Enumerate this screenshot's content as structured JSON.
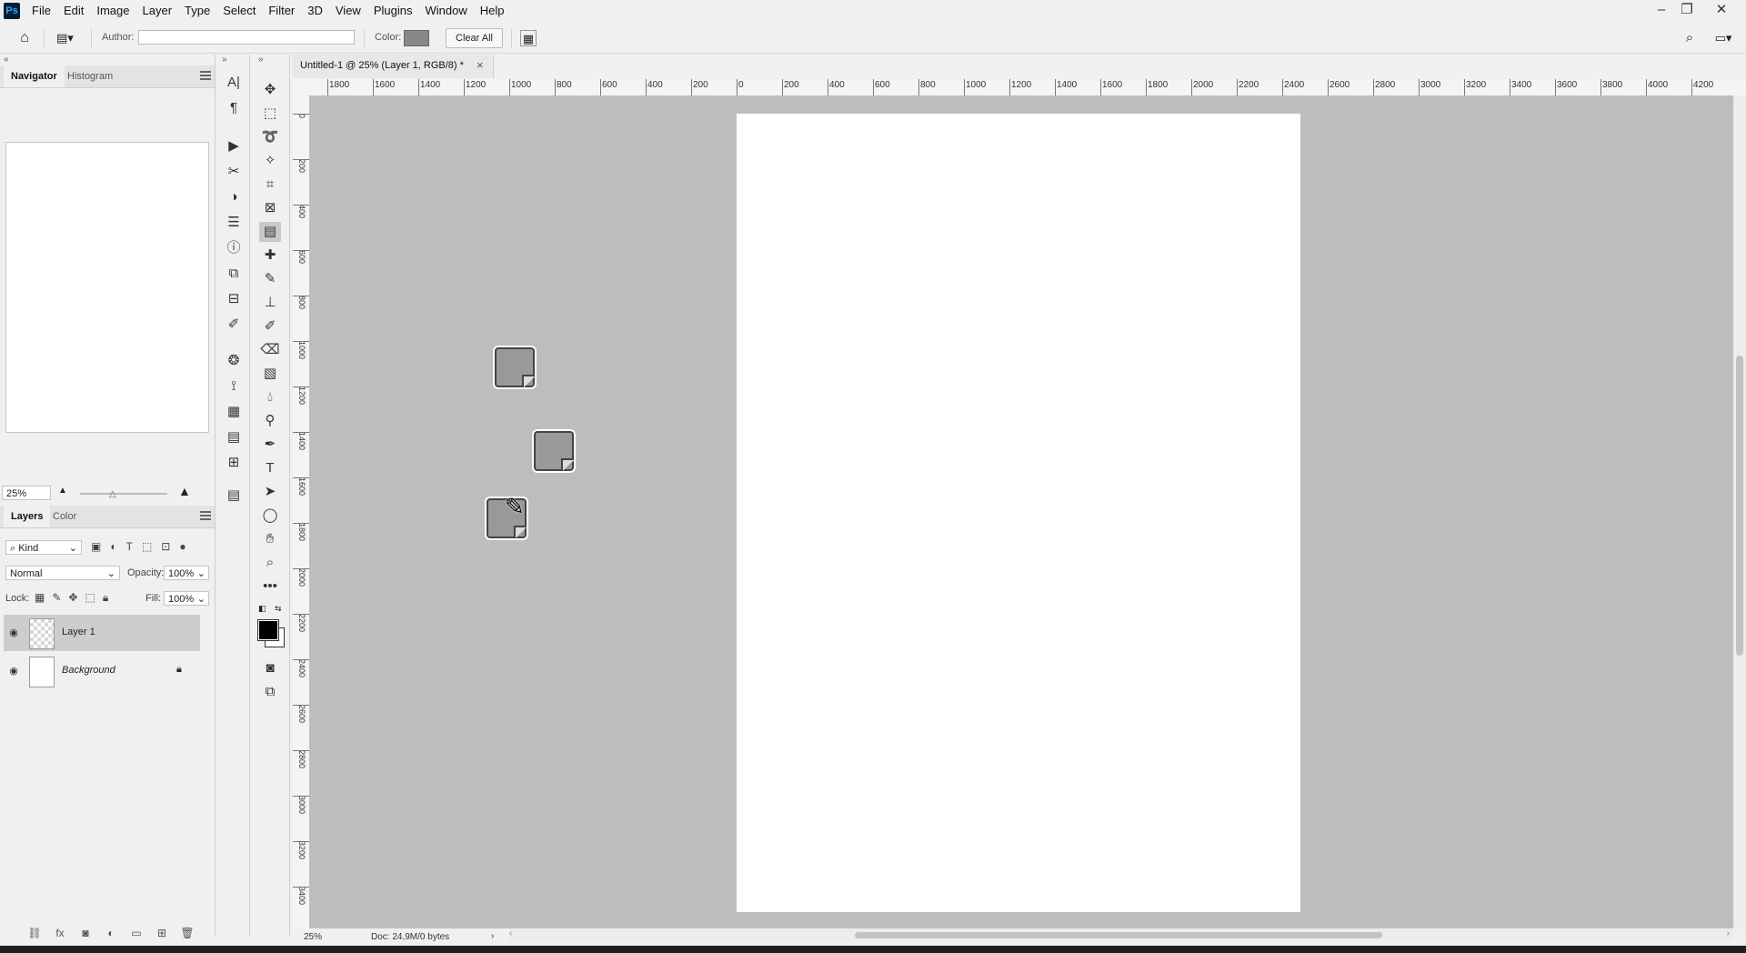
{
  "app": {
    "logo": "Ps"
  },
  "menu": [
    "File",
    "Edit",
    "Image",
    "Layer",
    "Type",
    "Select",
    "Filter",
    "3D",
    "View",
    "Plugins",
    "Window",
    "Help"
  ],
  "window_controls": {
    "minimize": "–",
    "restore": "❐",
    "close": "✕"
  },
  "options_bar": {
    "author_label": "Author:",
    "author_value": "",
    "color_label": "Color:",
    "color_value": "#888888",
    "clear_all_label": "Clear All"
  },
  "navigator_panel": {
    "tabs": [
      "Navigator",
      "Histogram"
    ],
    "zoom_value": "25%"
  },
  "layers_panel": {
    "tabs": [
      "Layers",
      "Color"
    ],
    "filter_kind": "Kind",
    "blend_mode": "Normal",
    "opacity_label": "Opacity:",
    "opacity_value": "100%",
    "lock_label": "Lock:",
    "fill_label": "Fill:",
    "fill_value": "100%",
    "layers": [
      {
        "name": "Layer 1",
        "selected": true
      },
      {
        "name": "Background",
        "selected": false,
        "locked": true
      }
    ]
  },
  "document": {
    "tab_title": "Untitled-1 @ 25% (Layer 1, RGB/8) *",
    "close_glyph": "×",
    "zoom": "25%",
    "doc_info": "Doc: 24,9M/0 bytes"
  },
  "ruler_h": [
    "1800",
    "1600",
    "1400",
    "1200",
    "1000",
    "800",
    "600",
    "400",
    "200",
    "0",
    "200",
    "400",
    "600",
    "800",
    "1000",
    "1200",
    "1400",
    "1600",
    "1800",
    "2000",
    "2200",
    "2400",
    "2600",
    "2800",
    "3000",
    "3200",
    "3400",
    "3600",
    "3800",
    "4000",
    "4200"
  ],
  "ruler_v": [
    "0",
    "200",
    "400",
    "600",
    "800",
    "1000",
    "1200",
    "1400",
    "1600",
    "1800",
    "2000",
    "2200",
    "2400",
    "2600",
    "2800",
    "3000",
    "3200",
    "3400"
  ]
}
